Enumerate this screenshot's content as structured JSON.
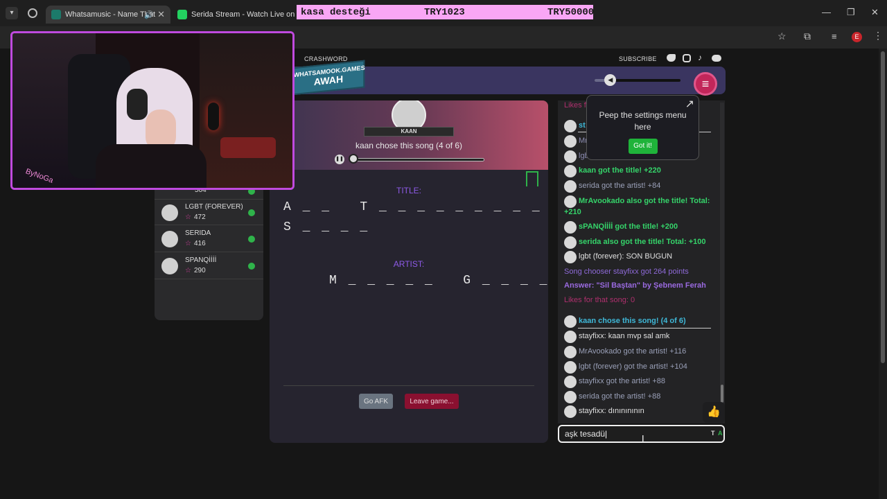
{
  "browser": {
    "tabs": [
      {
        "title": "Whatsamusic - Name That",
        "favicon_color": "#1c7a6a"
      },
      {
        "title": "Serida Stream - Watch Live on",
        "favicon_color": "#23d160"
      }
    ],
    "profile_initial": "E"
  },
  "banner": {
    "label": "kasa desteği",
    "current": "TRY1023",
    "goal": "TRY50000"
  },
  "site": {
    "nav_left": "CRASHWORD",
    "nav_subscribe": "SUBSCRIBE",
    "logo_line1": "WHATSAMOOK.GAMES",
    "logo_line2": "AWAH",
    "volume_level": 0.18
  },
  "leaderboard": {
    "partial_score": "504",
    "players": [
      {
        "name": "LGBT (FOREVER)",
        "points": "472"
      },
      {
        "name": "SERIDA",
        "points": "416"
      },
      {
        "name": "SPANQİİİİ",
        "points": "290"
      }
    ]
  },
  "game": {
    "chooser_name": "KAAN",
    "chose_text": "kaan chose this song (4 of 6)",
    "title_label": "TITLE:",
    "title_line1": "A _ _   T _ _ _ _ _ _ _ _ _ _",
    "title_line2": "S _ _ _ _",
    "artist_label": "ARTIST:",
    "artist_line": "M _ _ _ _ _   G _ _ _ _ _",
    "afk_button": "Go AFK",
    "leave_button": "Leave game..."
  },
  "chat": {
    "likes_partial": "Likes f",
    "messages": [
      {
        "text": "st",
        "color": "#3fb8d8",
        "bold": true,
        "avatar": true
      },
      {
        "text": "Mr",
        "color": "#8a8ab0",
        "bold": false,
        "avatar": true
      },
      {
        "text": "lgbt",
        "color": "#8a8ab0",
        "bold": false,
        "avatar": true
      },
      {
        "text": "kaan got the title! +220",
        "color": "#35d46a",
        "bold": true,
        "avatar": true
      },
      {
        "text": "serida got the artist! +84",
        "color": "#9aa0b8",
        "bold": false,
        "avatar": true
      },
      {
        "text": "MrAvookado also got the title! Total:",
        "color": "#35d46a",
        "bold": true,
        "avatar": true
      },
      {
        "text": "+210",
        "color": "#35d46a",
        "bold": true,
        "avatar": false
      },
      {
        "text": "sPANQİİİİ got the title! +200",
        "color": "#35d46a",
        "bold": true,
        "avatar": true
      },
      {
        "text": "serida also got the title! Total: +100",
        "color": "#35d46a",
        "bold": true,
        "avatar": true
      },
      {
        "text": "lgbt (forever): SON BUGUN",
        "color": "#e0e0e0",
        "bold": false,
        "avatar": true
      },
      {
        "text": "Song chooser stayfixx got 264 points",
        "color": "#8e6ad8",
        "bold": false,
        "avatar": false
      },
      {
        "text": "Answer: \"Sil Baştan\" by Şebnem Ferah",
        "color": "#9a6ae0",
        "bold": true,
        "avatar": false
      },
      {
        "text": "Likes for that song: 0",
        "color": "#b0306e",
        "bold": false,
        "avatar": false
      },
      {
        "text": "kaan chose this song! (4 of 6)",
        "color": "#3fb8d8",
        "bold": true,
        "avatar": true
      },
      {
        "text": "stayfixx: kaan mvp sal amk",
        "color": "#e0e0e0",
        "bold": false,
        "avatar": true
      },
      {
        "text": "MrAvookado got the artist! +116",
        "color": "#9aa0b8",
        "bold": false,
        "avatar": true
      },
      {
        "text": "lgbt (forever) got the artist! +104",
        "color": "#9aa0b8",
        "bold": false,
        "avatar": true
      },
      {
        "text": "stayfixx got the artist! +88",
        "color": "#9aa0b8",
        "bold": false,
        "avatar": true
      },
      {
        "text": "serida got the artist! +88",
        "color": "#9aa0b8",
        "bold": false,
        "avatar": true
      },
      {
        "text": "stayfixx: dınınınının",
        "color": "#e0e0e0",
        "bold": false,
        "avatar": true
      }
    ],
    "input_value": "aşk tesadü",
    "input_hint_t": "T",
    "input_hint_a": "A"
  },
  "tooltip": {
    "text": "Peep the settings menu here",
    "button": "Got it!"
  },
  "webcam": {
    "overlay_text": "ByNoGa"
  },
  "colors": {
    "accent_pink": "#d83ea0",
    "success_green": "#2fb34a",
    "leave_red": "#8a1030",
    "header_purple": "#3a3560"
  }
}
